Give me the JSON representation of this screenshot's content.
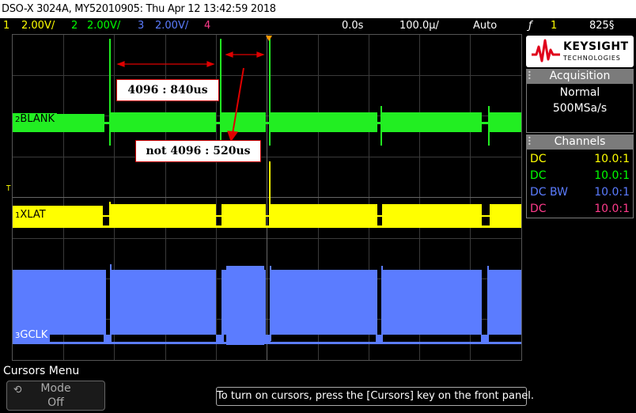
{
  "window": {
    "title": "DSO-X 3024A, MY52010905: Thu Apr 12 13:42:59 2018"
  },
  "statusbar": {
    "ch1_num": "1",
    "ch1_scale": "2.00V/",
    "ch2_num": "2",
    "ch2_scale": "2.00V/",
    "ch3_num": "3",
    "ch3_scale": "2.00V/",
    "ch4_num": "4",
    "time_delay": "0.0s",
    "time_scale": "100.0µ/",
    "trigger_mode": "Auto",
    "trigger_slope": "ƒ",
    "trigger_source": "1",
    "trigger_level": "825§"
  },
  "logo": {
    "brand": "KEYSIGHT",
    "sub": "TECHNOLOGIES"
  },
  "acquisition": {
    "header": "Acquisition",
    "mode": "Normal",
    "rate": "500MSa/s"
  },
  "channels_panel": {
    "header": "Channels",
    "rows": [
      {
        "coupling": "DC",
        "probe": "10.0:1",
        "color": "#ffff00"
      },
      {
        "coupling": "DC",
        "probe": "10.0:1",
        "color": "#00ff00"
      },
      {
        "coupling": "DC BW",
        "probe": "10.0:1",
        "color": "#5b7cff"
      },
      {
        "coupling": "DC",
        "probe": "10.0:1",
        "color": "#ff3b8b"
      }
    ]
  },
  "traces": {
    "blank": {
      "num": "2",
      "label": "BLANK",
      "color": "#22ee22"
    },
    "xlat": {
      "num": "1",
      "label": "XLAT",
      "color": "#ffff00"
    },
    "gclk": {
      "num": "3",
      "label": "GCLK",
      "color": "#5b7cff"
    },
    "trigger_marker": "T"
  },
  "annotations": {
    "a1": "4096 : 840us",
    "a2": "not 4096 : 520us"
  },
  "colors": {
    "ch1": "#ffff00",
    "ch2": "#00ff00",
    "ch3": "#5b7cff",
    "ch4": "#ff3b8b",
    "panel_header": "#7b7b7b",
    "logo_red": "#e0001b"
  },
  "menu": {
    "title": "Cursors Menu",
    "softkey_label": "Mode",
    "softkey_value": "Off"
  },
  "help": {
    "message": "To turn on cursors, press the [Cursors] key on the front panel."
  }
}
